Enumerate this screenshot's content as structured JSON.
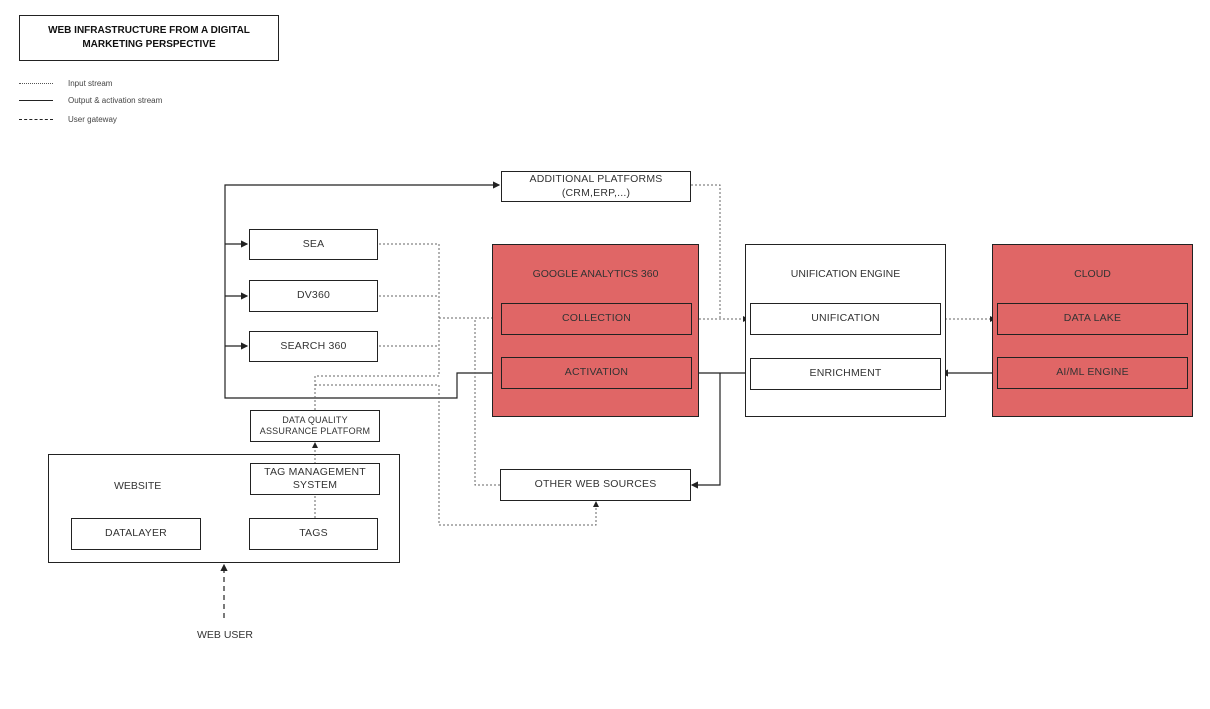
{
  "title": "WEB INFRASTRUCTURE FROM A DIGITAL MARKETING PERSPECTIVE",
  "title_lines": [
    "WEB INFRASTRUCTURE FROM A DIGITAL",
    "MARKETING PERSPECTIVE"
  ],
  "legend": [
    {
      "style": "dotted",
      "label": "Input stream"
    },
    {
      "style": "solid",
      "label": "Output & activation stream"
    },
    {
      "style": "dashed",
      "label": "User gateway"
    }
  ],
  "colors": {
    "accent_red": "#e06666",
    "stroke": "#222222"
  },
  "nodes": {
    "additional_platforms": {
      "line1": "ADDITIONAL PLATFORMS",
      "line2": "(CRM,ERP,...)"
    },
    "sea": "SEA",
    "dv360": "DV360",
    "search360": "SEARCH 360",
    "data_quality": {
      "line1": "DATA QUALITY",
      "line2": "ASSURANCE PLATFORM"
    },
    "website": "WEBSITE",
    "tag_management": {
      "line1": "TAG MANAGEMENT",
      "line2": "SYSTEM"
    },
    "datalayer": "DATALAYER",
    "tags": "TAGS",
    "web_user": "WEB USER",
    "other_web_sources": "OTHER WEB SOURCES",
    "ga360": {
      "label": "GOOGLE ANALYTICS 360",
      "collection": "COLLECTION",
      "activation": "ACTIVATION"
    },
    "unification_engine": {
      "label": "UNIFICATION ENGINE",
      "unification": "UNIFICATION",
      "enrichment": "ENRICHMENT"
    },
    "cloud": {
      "label": "CLOUD",
      "data_lake": "DATA LAKE",
      "aiml": "AI/ML ENGINE"
    }
  }
}
